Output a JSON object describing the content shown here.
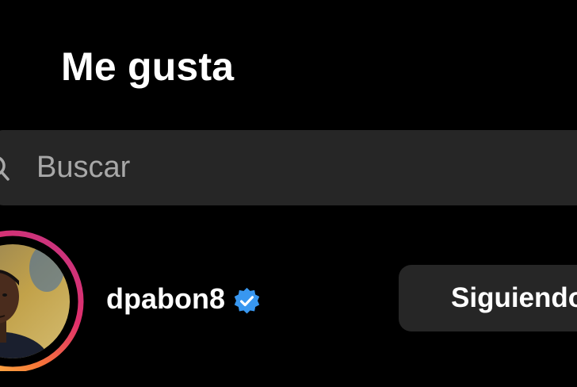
{
  "header": {
    "title": "Me gusta"
  },
  "search": {
    "placeholder": "Buscar",
    "icon": "search-icon"
  },
  "likes_list": [
    {
      "username": "dpabon8",
      "verified": true,
      "follow_button_label": "Siguiendo",
      "avatar_ring": "story-gradient"
    }
  ],
  "colors": {
    "background": "#000000",
    "surface": "#262626",
    "text_primary": "#ffffff",
    "text_secondary": "#a8a8a8",
    "verified_blue": "#3897f0",
    "ring_gradient": [
      "#c13584",
      "#e1306c",
      "#f77737",
      "#fcaf45"
    ]
  }
}
